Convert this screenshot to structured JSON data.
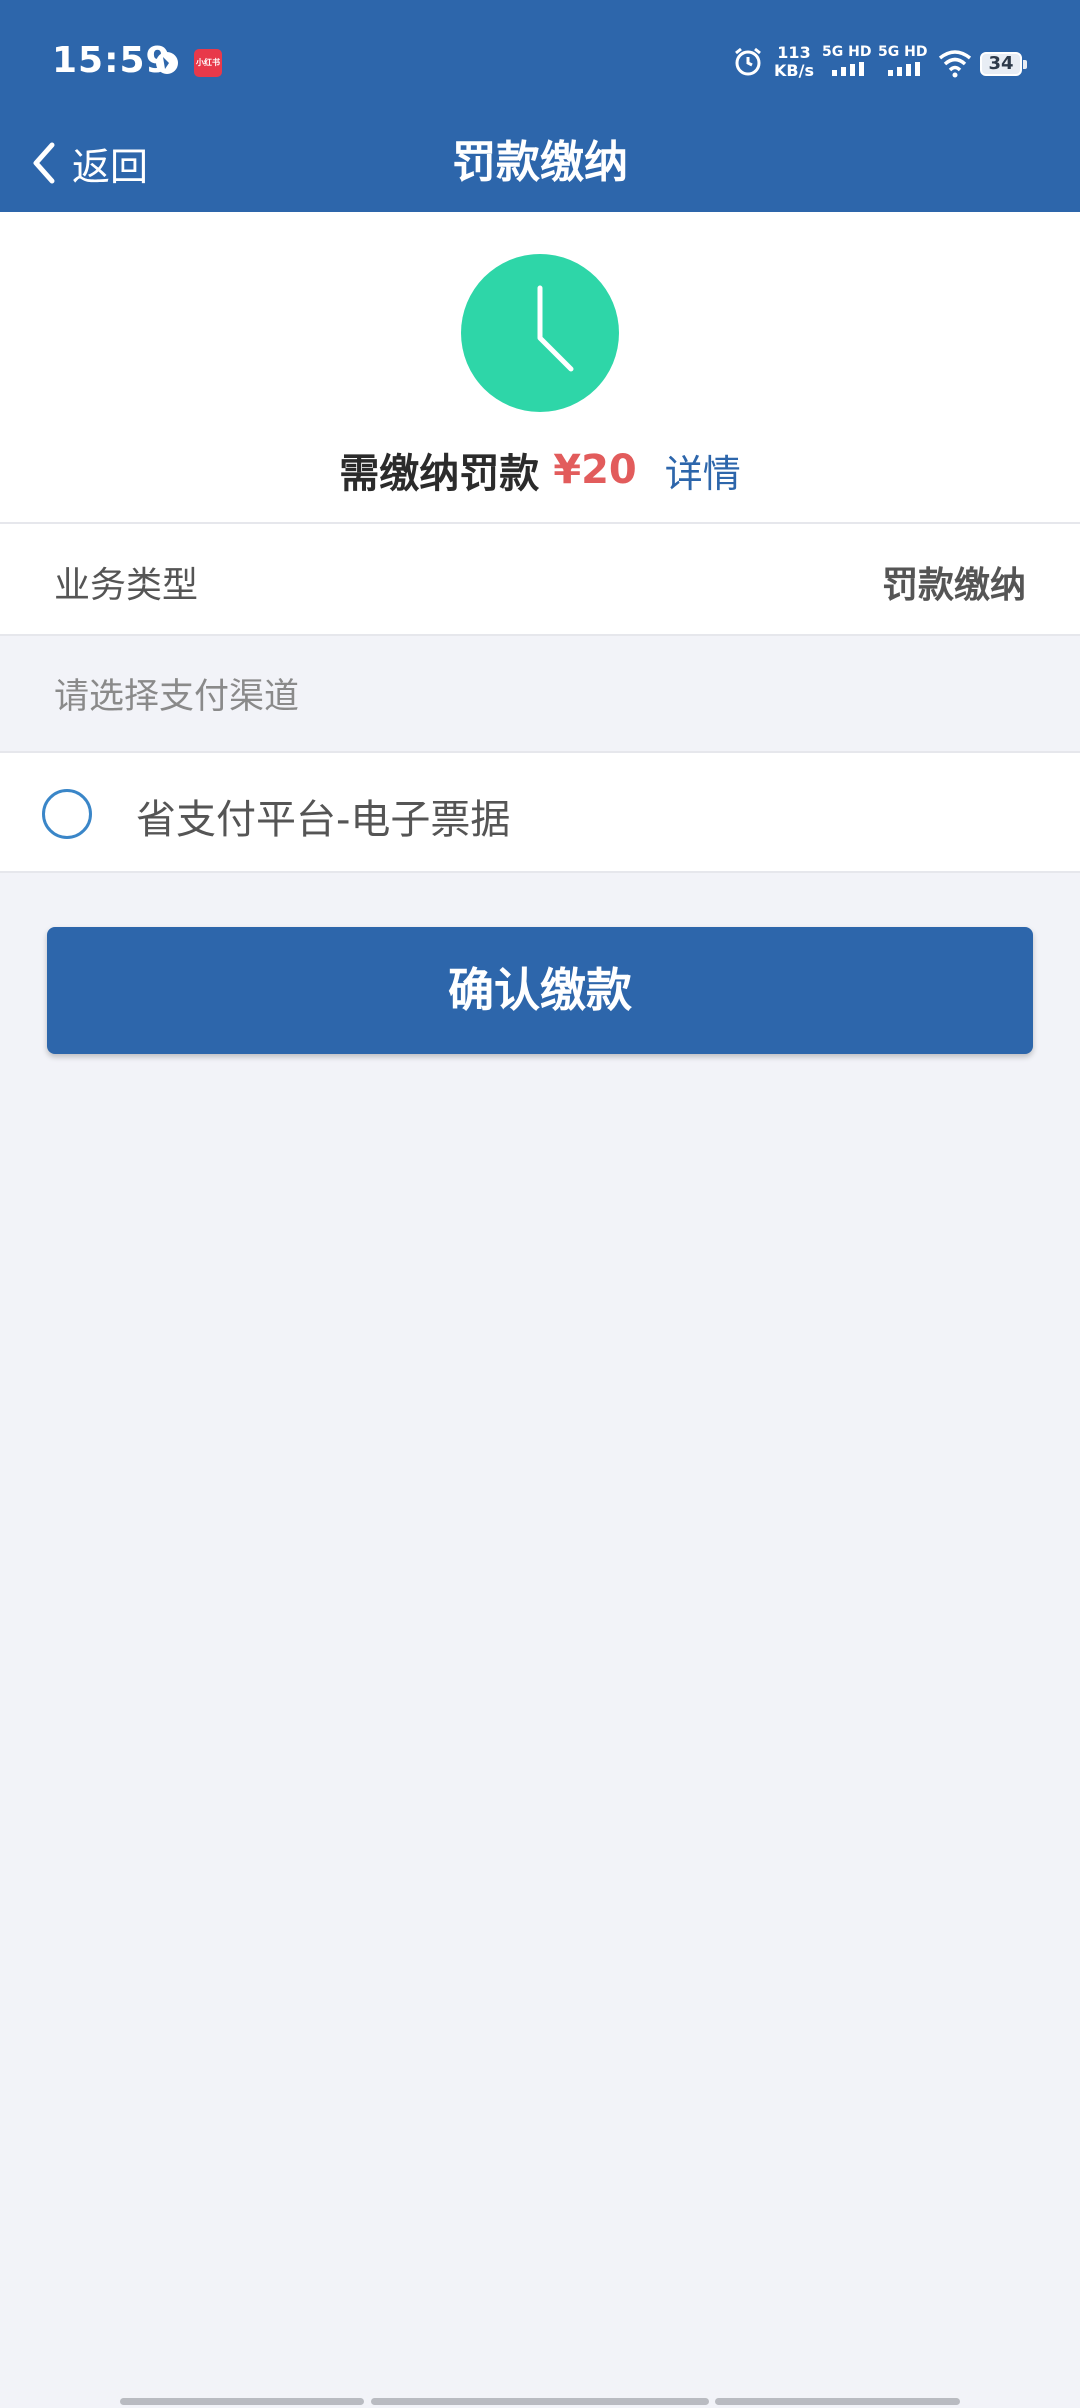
{
  "status_bar": {
    "time": "15:59",
    "app_badge": "小红书",
    "network_speed": "113",
    "network_speed_unit": "KB/s",
    "signal1_label": "5G HD",
    "signal2_label": "5G HD",
    "battery": "34"
  },
  "nav": {
    "back_label": "返回",
    "title": "罚款缴纳"
  },
  "summary": {
    "amount_label": "需缴纳罚款",
    "amount": "¥20",
    "details_link": "详情",
    "icon_color": "#2ed6a8"
  },
  "business": {
    "label": "业务类型",
    "value": "罚款缴纳"
  },
  "payment": {
    "hint": "请选择支付渠道",
    "options": [
      {
        "label": "省支付平台-电子票据",
        "selected": false
      }
    ]
  },
  "confirm_button": "确认缴款",
  "colors": {
    "primary": "#2d66ab",
    "amount": "#e25c5c",
    "background": "#f2f3f8"
  }
}
